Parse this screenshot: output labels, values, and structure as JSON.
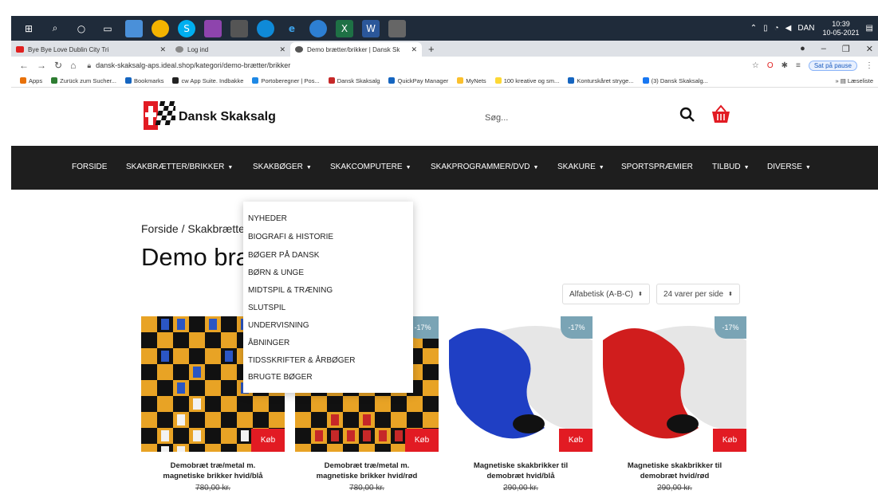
{
  "taskbar": {
    "lang": "DAN",
    "time": "10:39",
    "date": "10-05-2021"
  },
  "tabs": [
    {
      "label": "Bye Bye Love Dublin City Tri",
      "active": false,
      "color": "#e02020"
    },
    {
      "label": "Log ind",
      "active": false,
      "color": "#888888"
    },
    {
      "label": "Demo brætter/brikker | Dansk Sk",
      "active": true,
      "color": "#555555"
    }
  ],
  "addressbar": {
    "url": "dansk-skaksalg-aps.ideal.shop/kategori/demo-brætter/brikker",
    "pause_label": "Sat på pause"
  },
  "bookmarks": {
    "items": [
      {
        "label": "Apps",
        "color": "#e8710a"
      },
      {
        "label": "Zurück zum Sucher...",
        "color": "#2e7d32"
      },
      {
        "label": "Bookmarks",
        "color": "#1565c0"
      },
      {
        "label": "cw App Suite. Indbakke",
        "color": "#222222"
      },
      {
        "label": "Portoberegner | Pos...",
        "color": "#1e88e5"
      },
      {
        "label": "Dansk Skaksalg",
        "color": "#c62828"
      },
      {
        "label": "QuickPay Manager",
        "color": "#1565c0"
      },
      {
        "label": "MyNets",
        "color": "#fbc02d"
      },
      {
        "label": "100 kreative og sm...",
        "color": "#fdd835"
      },
      {
        "label": "Konturskåret stryge...",
        "color": "#1565c0"
      },
      {
        "label": "(3) Dansk Skaksalg...",
        "color": "#1877f2"
      }
    ],
    "reading_list": "Læseliste"
  },
  "site": {
    "logo_text": "Dansk Skaksalg",
    "search_placeholder": "Søg...",
    "accent": "#e21b23"
  },
  "nav": [
    {
      "label": "FORSIDE",
      "caret": ""
    },
    {
      "label": "SKAKBRÆTTER/BRIKKER",
      "caret": "▼"
    },
    {
      "label": "SKAKBØGER",
      "caret": "▼"
    },
    {
      "label": "SKAKCOMPUTERE",
      "caret": "▼"
    },
    {
      "label": "SKAKPROGRAMMER/DVD",
      "caret": "▼"
    },
    {
      "label": "SKAKURE",
      "caret": "▼"
    },
    {
      "label": "SPORTSPRÆMIER",
      "caret": ""
    },
    {
      "label": "TILBUD",
      "caret": "▼"
    },
    {
      "label": "DIVERSE",
      "caret": "▼"
    }
  ],
  "breadcrumb": "Forside / Skakbrætter",
  "page_title": "Demo bræ",
  "sort": {
    "order": "Alfabetisk (A-B-C)",
    "per_page": "24 varer per side",
    "caret": "⬍"
  },
  "dropdown": [
    "NYHEDER",
    "BIOGRAFI & HISTORIE",
    "BØGER PÅ DANSK",
    "BØRN & UNGE",
    "MIDTSPIL & TRÆNING",
    "SLUTSPIL",
    "UNDERVISNING",
    "ÅBNINGER",
    "TIDSSKRIFTER & ÅRBØGER",
    "BRUGTE BØGER"
  ],
  "products": [
    {
      "name_line1": "Demobræt træ/metal m.",
      "name_line2": "magnetiske brikker hvid/blå",
      "price": "780,00 kr.",
      "badge": "",
      "buy": "Køb",
      "piece_color": "#2b56c4"
    },
    {
      "name_line1": "Demobræt træ/metal m.",
      "name_line2": "magnetiske brikker hvid/rød",
      "price": "780,00 kr.",
      "badge": "-17%",
      "buy": "Køb",
      "piece_color": "#c62828"
    },
    {
      "name_line1": "Magnetiske skakbrikker til",
      "name_line2": "demobræt hvid/blå",
      "price": "290,00 kr.",
      "badge": "-17%",
      "buy": "Køb",
      "piece_color": "#1f3fc4"
    },
    {
      "name_line1": "Magnetiske skakbrikker til",
      "name_line2": "demobræt hvid/rød",
      "price": "290,00 kr.",
      "badge": "-17%",
      "buy": "Køb",
      "piece_color": "#d01d1d"
    }
  ]
}
